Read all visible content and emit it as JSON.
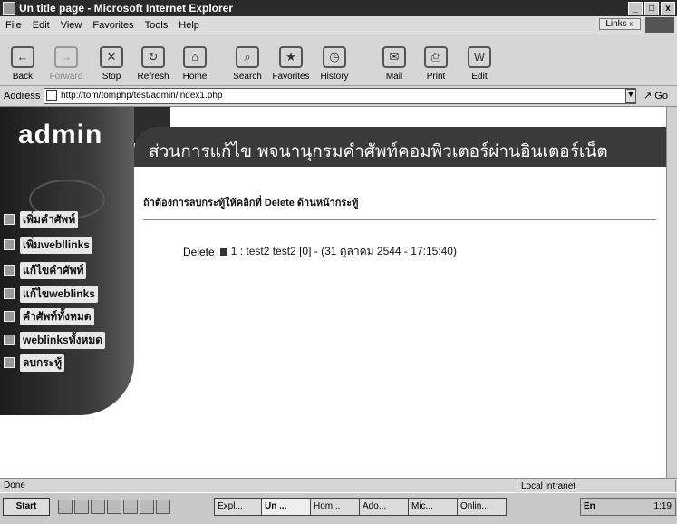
{
  "window": {
    "title": "Un title page - Microsoft Internet Explorer",
    "controls": [
      "_",
      "□",
      "x"
    ]
  },
  "menu": {
    "items": [
      "File",
      "Edit",
      "View",
      "Favorites",
      "Tools",
      "Help"
    ],
    "links": "Links »"
  },
  "toolbar": {
    "buttons": [
      "Back",
      "Forward",
      "Stop",
      "Refresh",
      "Home",
      "Search",
      "Favorites",
      "History",
      "Mail",
      "Print",
      "Edit"
    ]
  },
  "address": {
    "label": "Address",
    "url": "http://tom/tomphp/test/admin/index1.php",
    "go": "Go"
  },
  "page": {
    "logo": "admin",
    "header_title": "ส่วนการแก้ไข พจนานุกรมคำศัพท์คอมพิวเตอร์ผ่านอินเตอร์เน็ต",
    "sidebar_items": [
      "เพิ่มคำศัพท์",
      "เพิ่มwebllinks",
      "แก้ไขคำศัพท์",
      "แก้ไขweblinks",
      "คำศัพท์ทั้งหมด",
      "weblinksทั้งหมด",
      "ลบกระทู้"
    ],
    "instruction": "ถ้าต้องการลบกระทู้ให้คลิกที่ Delete ด้านหน้ากระทู้",
    "entry": {
      "delete_label": "Delete",
      "text": "1 : test2 test2 [0] - (31 ตุลาคม 2544 - 17:15:40)"
    }
  },
  "status": {
    "left": "Done",
    "zone": "Local intranet"
  },
  "taskbar": {
    "start": "Start",
    "tasks": [
      "Expl...",
      "Un ...",
      "Hom...",
      "Ado...",
      "Mic...",
      "Onlin..."
    ],
    "tray_lang": "En",
    "time": "1:19"
  }
}
